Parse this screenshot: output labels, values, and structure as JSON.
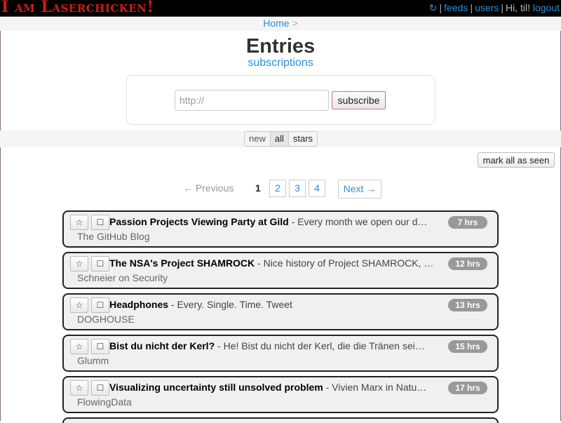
{
  "header": {
    "brand": "I am Laserchicken!",
    "refresh_icon": "↻",
    "feeds_label": "feeds",
    "users_label": "users",
    "greeting": "Hi, til!",
    "logout_label": "logout",
    "separator": "|"
  },
  "breadcrumb": {
    "home_label": "Home",
    "divider": ">"
  },
  "page": {
    "title": "Entries",
    "subscriptions_link": "subscriptions"
  },
  "subscribe": {
    "placeholder": "http://",
    "value": "",
    "button_label": "subscribe"
  },
  "filters": {
    "new_label": "new",
    "all_label": "all",
    "stars_label": "stars",
    "selected": "all"
  },
  "mark_all_label": "mark all as seen",
  "pagination": {
    "previous_label": "← Previous",
    "current": "1",
    "pages": [
      "2",
      "3",
      "4"
    ],
    "next_label": "Next →"
  },
  "entry_buttons": {
    "star_icon": "☆",
    "seen_icon": "☐"
  },
  "entries": [
    {
      "title": "Passion Projects Viewing Party at Gild",
      "separator": " - ",
      "summary": "Every month we open our d…",
      "feed": "The GitHub Blog",
      "age": "7 hrs"
    },
    {
      "title": "The NSA's Project SHAMROCK",
      "separator": " - ",
      "summary": "Nice history of Project SHAMROCK, …",
      "feed": "Schneier on Security",
      "age": "12 hrs"
    },
    {
      "title": "Headphones",
      "separator": " - ",
      "summary": "Every. Single. Time. Tweet",
      "feed": "DOGHOUSE",
      "age": "13 hrs"
    },
    {
      "title": "Bist du nicht der Kerl?",
      "separator": " - ",
      "summary": "He! Bist du nicht der Kerl, die die Tränen sei…",
      "feed": "Glumm",
      "age": "15 hrs"
    },
    {
      "title": "Visualizing uncertainty still unsolved problem",
      "separator": " - ",
      "summary": "Vivien Marx in Natu…",
      "feed": "FlowingData",
      "age": "17 hrs"
    }
  ]
}
